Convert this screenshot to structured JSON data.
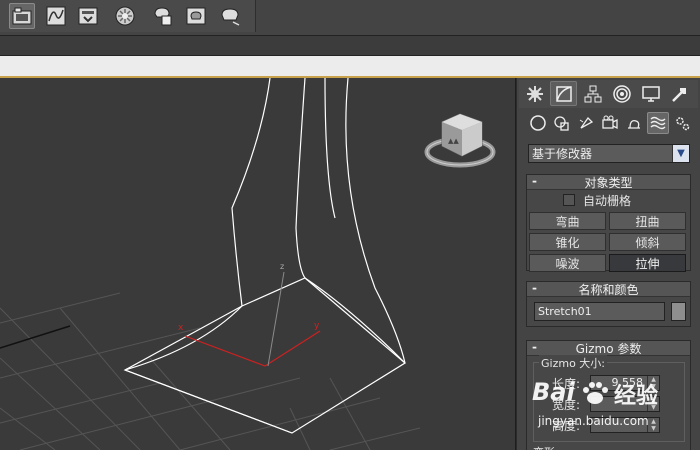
{
  "toolbar": {
    "icons": [
      "schematic-view-icon",
      "curve-editor-icon",
      "render-setup-icon",
      "material-editor-icon",
      "render-frame-icon",
      "render-icon",
      "render-iterative-icon"
    ]
  },
  "command_panel": {
    "tabs": [
      "create-tab",
      "modify-tab",
      "hierarchy-tab",
      "motion-tab",
      "display-tab",
      "utilities-tab"
    ],
    "active_tab": "modify-tab",
    "subcategory_icons": [
      "geometry-icon",
      "shapes-icon",
      "lights-icon",
      "cameras-icon",
      "helpers-icon",
      "space-warps-icon",
      "systems-icon"
    ],
    "dropdown_value": "基于修改器",
    "object_type": {
      "title": "对象类型",
      "autogrid_label": "自动栅格",
      "buttons": [
        {
          "label": "弯曲",
          "pressed": false
        },
        {
          "label": "扭曲",
          "pressed": false
        },
        {
          "label": "锥化",
          "pressed": false
        },
        {
          "label": "倾斜",
          "pressed": false
        },
        {
          "label": "噪波",
          "pressed": false
        },
        {
          "label": "拉伸",
          "pressed": true
        }
      ]
    },
    "name_color": {
      "title": "名称和颜色",
      "object_name": "Stretch01",
      "color": "#8e8e8e"
    },
    "gizmo": {
      "title": "Gizmo 参数",
      "group_title": "Gizmo 大小:",
      "length_label": "长度:",
      "length_value": "9.558",
      "width_label": "宽度:",
      "width_value": "",
      "height_label": "高度:",
      "height_value": "",
      "next_section": "变形"
    }
  },
  "watermark": {
    "brand": "Bai",
    "brand_suffix": "经验",
    "url": "jingyan.baidu.com"
  },
  "colors": {
    "viewport_bg": "#3a3a3a",
    "wireframe": "#ffffff",
    "gizmo_axis": "#d02020",
    "grid": "#555555"
  }
}
